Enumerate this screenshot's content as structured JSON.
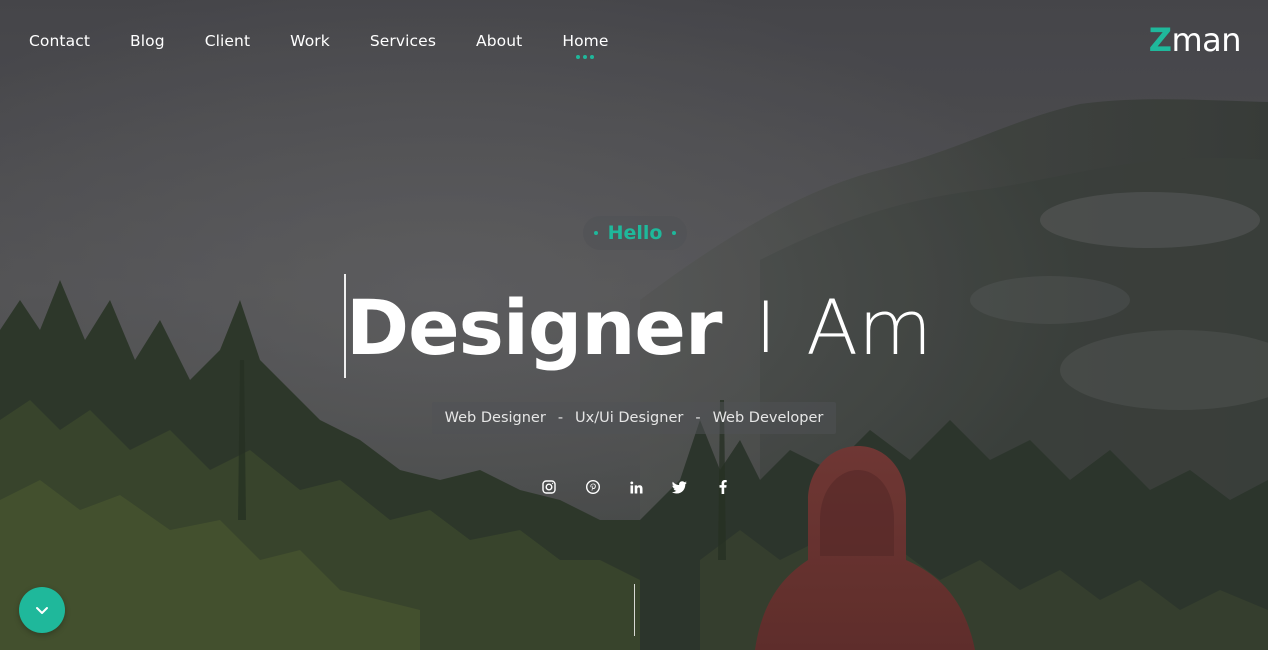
{
  "theme": {
    "accent": "#1fb89b",
    "text": "#ffffff"
  },
  "nav": {
    "items": [
      {
        "label": "Contact",
        "active": false
      },
      {
        "label": "Blog",
        "active": false
      },
      {
        "label": "Client",
        "active": false
      },
      {
        "label": "Work",
        "active": false
      },
      {
        "label": "Services",
        "active": false
      },
      {
        "label": "About",
        "active": false
      },
      {
        "label": "Home",
        "active": true
      }
    ]
  },
  "logo": {
    "initial": "Z",
    "rest": "man"
  },
  "hero": {
    "greeting": "Hello",
    "headline_main": "Designer",
    "headline_sep": "I",
    "headline_end": "Am",
    "roles": [
      "Web Designer",
      "Ux/Ui Designer",
      "Web Developer"
    ],
    "role_separator": "-"
  },
  "socials": [
    {
      "icon": "instagram-icon"
    },
    {
      "icon": "pinterest-icon"
    },
    {
      "icon": "linkedin-icon"
    },
    {
      "icon": "twitter-icon"
    },
    {
      "icon": "facebook-icon"
    }
  ],
  "scroll_button": {
    "icon": "chevron-down-icon"
  }
}
